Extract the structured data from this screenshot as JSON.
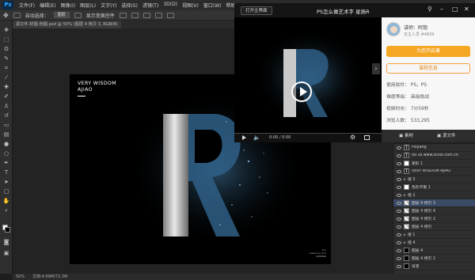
{
  "ps": {
    "logo": "Ps",
    "menu": [
      "文件(F)",
      "编辑(E)",
      "图像(I)",
      "图层(L)",
      "文字(Y)",
      "选择(S)",
      "滤镜(T)",
      "3D(D)",
      "视图(V)",
      "窗口(W)",
      "帮助(H)"
    ],
    "options": {
      "auto_select_label": "自动选择：",
      "auto_select_value": "图层",
      "show_transform_label": "显示变换控件"
    },
    "doc_tab": "源文件-样图-例图.psd @ 50% (图层 4 拷贝 3, RGB/8)",
    "status": {
      "zoom": "50%",
      "doc_size": "文档:4.69M/72.3M"
    },
    "artwork": {
      "title_line1": "VERY WISDOM",
      "title_line2": "AJIAO",
      "footer": "R-1\nwww.xxx.com\nRRRRRR"
    },
    "layers": [
      {
        "name": "Feiyang",
        "thumb": "text"
      },
      {
        "name": "tel us www.zcool.com.cn",
        "thumb": "text"
      },
      {
        "name": "矩形 1",
        "thumb": "white"
      },
      {
        "name": "VERY WISDOM AJIAO",
        "thumb": "text"
      },
      {
        "name": "组 3",
        "thumb": "folder"
      },
      {
        "name": "色阶平衡 1",
        "thumb": "white"
      },
      {
        "name": "组 2",
        "thumb": "folder"
      },
      {
        "name": "图层 4 拷贝 3",
        "thumb": "checker",
        "selected": true
      },
      {
        "name": "图层 4 拷贝 4",
        "thumb": "checker"
      },
      {
        "name": "图层 4 拷贝 2",
        "thumb": "checker"
      },
      {
        "name": "图层 4 拷贝",
        "thumb": "checker"
      },
      {
        "name": "组 1",
        "thumb": "folder"
      },
      {
        "name": "组 4",
        "thumb": "folder"
      },
      {
        "name": "图层 4",
        "thumb": "black"
      },
      {
        "name": "图层 4 拷贝 2",
        "thumb": "black"
      },
      {
        "name": "背景",
        "thumb": "black"
      }
    ]
  },
  "video": {
    "open_main_label": "打开主界面",
    "title": "PS怎么做艺术字 星扬R",
    "time": "0:00 / 0:00",
    "progress": 0
  },
  "info": {
    "teacher_name": "讲师：阿饱",
    "teacher_sub": "无主人员  #4839",
    "become_student_label": "为您开启兼",
    "course_info_label": "课程信息",
    "software": "使用软件： PS，PS",
    "difficulty": "难度等级： 高级挑战",
    "duration": "视频时长： 7分59秒",
    "learners": "浏览人数： 533,295",
    "tab_material": "素材",
    "tab_source": "源文件"
  },
  "colors": {
    "accent_orange": "#f5a623",
    "progress_blue": "#4aa3ff",
    "ps_blue": "#31a8ff"
  }
}
